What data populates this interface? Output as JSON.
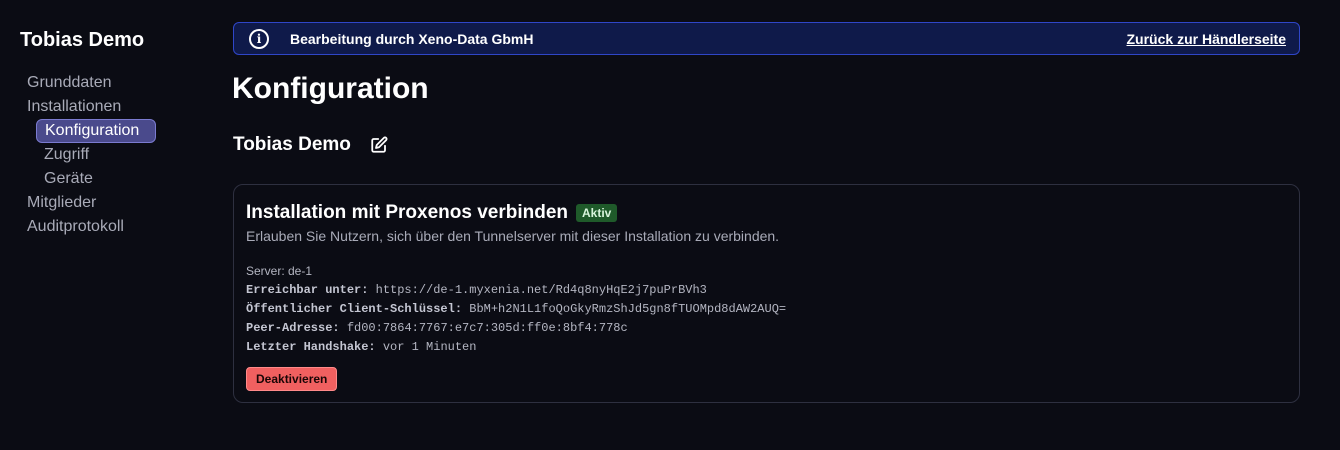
{
  "sidebar": {
    "title": "Tobias Demo",
    "items": [
      {
        "label": "Grunddaten"
      },
      {
        "label": "Installationen"
      },
      {
        "label": "Konfiguration"
      },
      {
        "label": "Zugriff"
      },
      {
        "label": "Geräte"
      },
      {
        "label": "Mitglieder"
      },
      {
        "label": "Auditprotokoll"
      }
    ]
  },
  "banner": {
    "icon": "info-icon",
    "text": "Bearbeitung durch Xeno-Data GbmH",
    "link": "Zurück zur Händlerseite",
    "accent": "#2f46c8"
  },
  "page": {
    "title": "Konfiguration",
    "subheading": "Tobias Demo"
  },
  "card": {
    "title": "Installation mit Proxenos verbinden",
    "badge": "Aktiv",
    "description": "Erlauben Sie Nutzern, sich über den Tunnelserver mit dieser Installation zu verbinden.",
    "server": "Server: de-1",
    "details": [
      {
        "key": "Erreichbar unter:",
        "value": "https://de-1.myxenia.net/Rd4q8nyHqE2j7puPrBVh3"
      },
      {
        "key": "Öffentlicher Client-Schlüssel:",
        "value": "BbM+h2N1L1foQoGkyRmzShJd5gn8fTUOMpd8dAW2AUQ="
      },
      {
        "key": "Peer-Adresse:",
        "value": "fd00:7864:7767:e7c7:305d:ff0e:8bf4:778c"
      },
      {
        "key": "Letzter Handshake:",
        "value": "vor 1 Minuten"
      }
    ],
    "button": "Deaktivieren",
    "badge_color": "#1f5a2a",
    "button_color": "#f06060"
  }
}
